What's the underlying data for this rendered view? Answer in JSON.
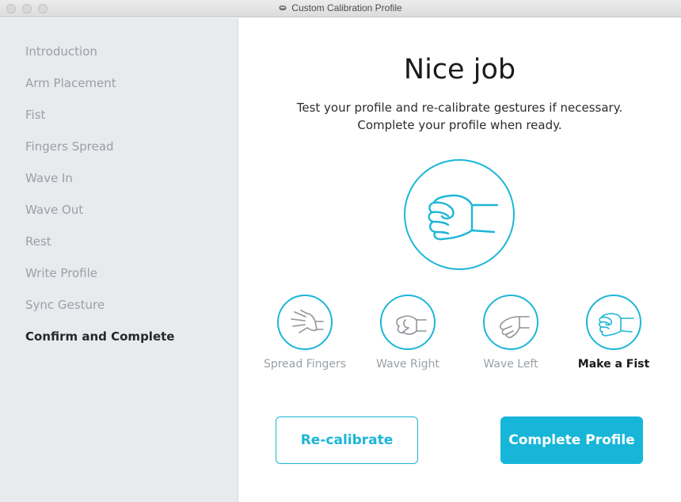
{
  "window": {
    "title": "Custom Calibration Profile",
    "title_icon": "myo-armband-icon"
  },
  "sidebar": {
    "items": [
      {
        "label": "Introduction",
        "active": false
      },
      {
        "label": "Arm Placement",
        "active": false
      },
      {
        "label": "Fist",
        "active": false
      },
      {
        "label": "Fingers Spread",
        "active": false
      },
      {
        "label": "Wave In",
        "active": false
      },
      {
        "label": "Wave Out",
        "active": false
      },
      {
        "label": "Rest",
        "active": false
      },
      {
        "label": "Write Profile",
        "active": false
      },
      {
        "label": "Sync Gesture",
        "active": false
      },
      {
        "label": "Confirm and Complete",
        "active": true
      }
    ]
  },
  "main": {
    "heading": "Nice job",
    "subtitle_line1": "Test your profile and re-calibrate gestures if necessary.",
    "subtitle_line2": "Complete your profile when ready.",
    "current_gesture_icon": "fist-icon",
    "gestures": [
      {
        "label": "Spread Fingers",
        "icon": "spread-fingers-icon",
        "active": false
      },
      {
        "label": "Wave Right",
        "icon": "wave-right-icon",
        "active": false
      },
      {
        "label": "Wave Left",
        "icon": "wave-left-icon",
        "active": false
      },
      {
        "label": "Make a Fist",
        "icon": "fist-icon",
        "active": true
      }
    ],
    "recalibrate_label": "Re-calibrate",
    "complete_label": "Complete Profile"
  },
  "colors": {
    "accent": "#1cb6d7",
    "inactive_text": "#9aa0a6",
    "sidebar_bg": "#e8ebee"
  }
}
